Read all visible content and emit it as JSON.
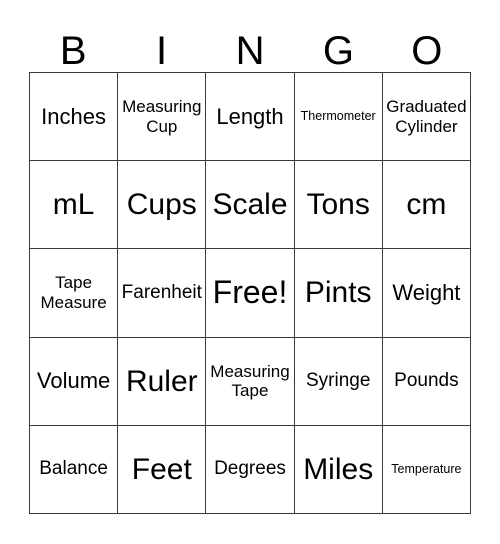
{
  "header": {
    "letters": [
      "B",
      "I",
      "N",
      "G",
      "O"
    ]
  },
  "grid": {
    "rows": 5,
    "columns": 5,
    "cells": [
      {
        "label": "Inches",
        "size": "md",
        "lines": 1
      },
      {
        "label": "Measuring\nCup",
        "size": "two",
        "lines": 2
      },
      {
        "label": "Length",
        "size": "md",
        "lines": 1
      },
      {
        "label": "Thermometer",
        "size": "xs",
        "lines": 1
      },
      {
        "label": "Graduated\nCylinder",
        "size": "two",
        "lines": 2
      },
      {
        "label": "mL",
        "size": "lg",
        "lines": 1
      },
      {
        "label": "Cups",
        "size": "lg",
        "lines": 1
      },
      {
        "label": "Scale",
        "size": "lg",
        "lines": 1
      },
      {
        "label": "Tons",
        "size": "lg",
        "lines": 1
      },
      {
        "label": "cm",
        "size": "lg",
        "lines": 1
      },
      {
        "label": "Tape\nMeasure",
        "size": "two",
        "lines": 2
      },
      {
        "label": "Farenheit",
        "size": "sm",
        "lines": 1
      },
      {
        "label": "Free!",
        "size": "xl",
        "lines": 1
      },
      {
        "label": "Pints",
        "size": "lg",
        "lines": 1
      },
      {
        "label": "Weight",
        "size": "md",
        "lines": 1
      },
      {
        "label": "Volume",
        "size": "md",
        "lines": 1
      },
      {
        "label": "Ruler",
        "size": "lg",
        "lines": 1
      },
      {
        "label": "Measuring\nTape",
        "size": "two",
        "lines": 2
      },
      {
        "label": "Syringe",
        "size": "sm",
        "lines": 1
      },
      {
        "label": "Pounds",
        "size": "sm",
        "lines": 1
      },
      {
        "label": "Balance",
        "size": "sm",
        "lines": 1
      },
      {
        "label": "Feet",
        "size": "lg",
        "lines": 1
      },
      {
        "label": "Degrees",
        "size": "sm",
        "lines": 1
      },
      {
        "label": "Miles",
        "size": "lg",
        "lines": 1
      },
      {
        "label": "Temperature",
        "size": "xs",
        "lines": 1
      }
    ],
    "free_space_index": 12
  },
  "colors": {
    "background": "#ffffff",
    "text": "#000000",
    "border": "#3a3a3a"
  }
}
